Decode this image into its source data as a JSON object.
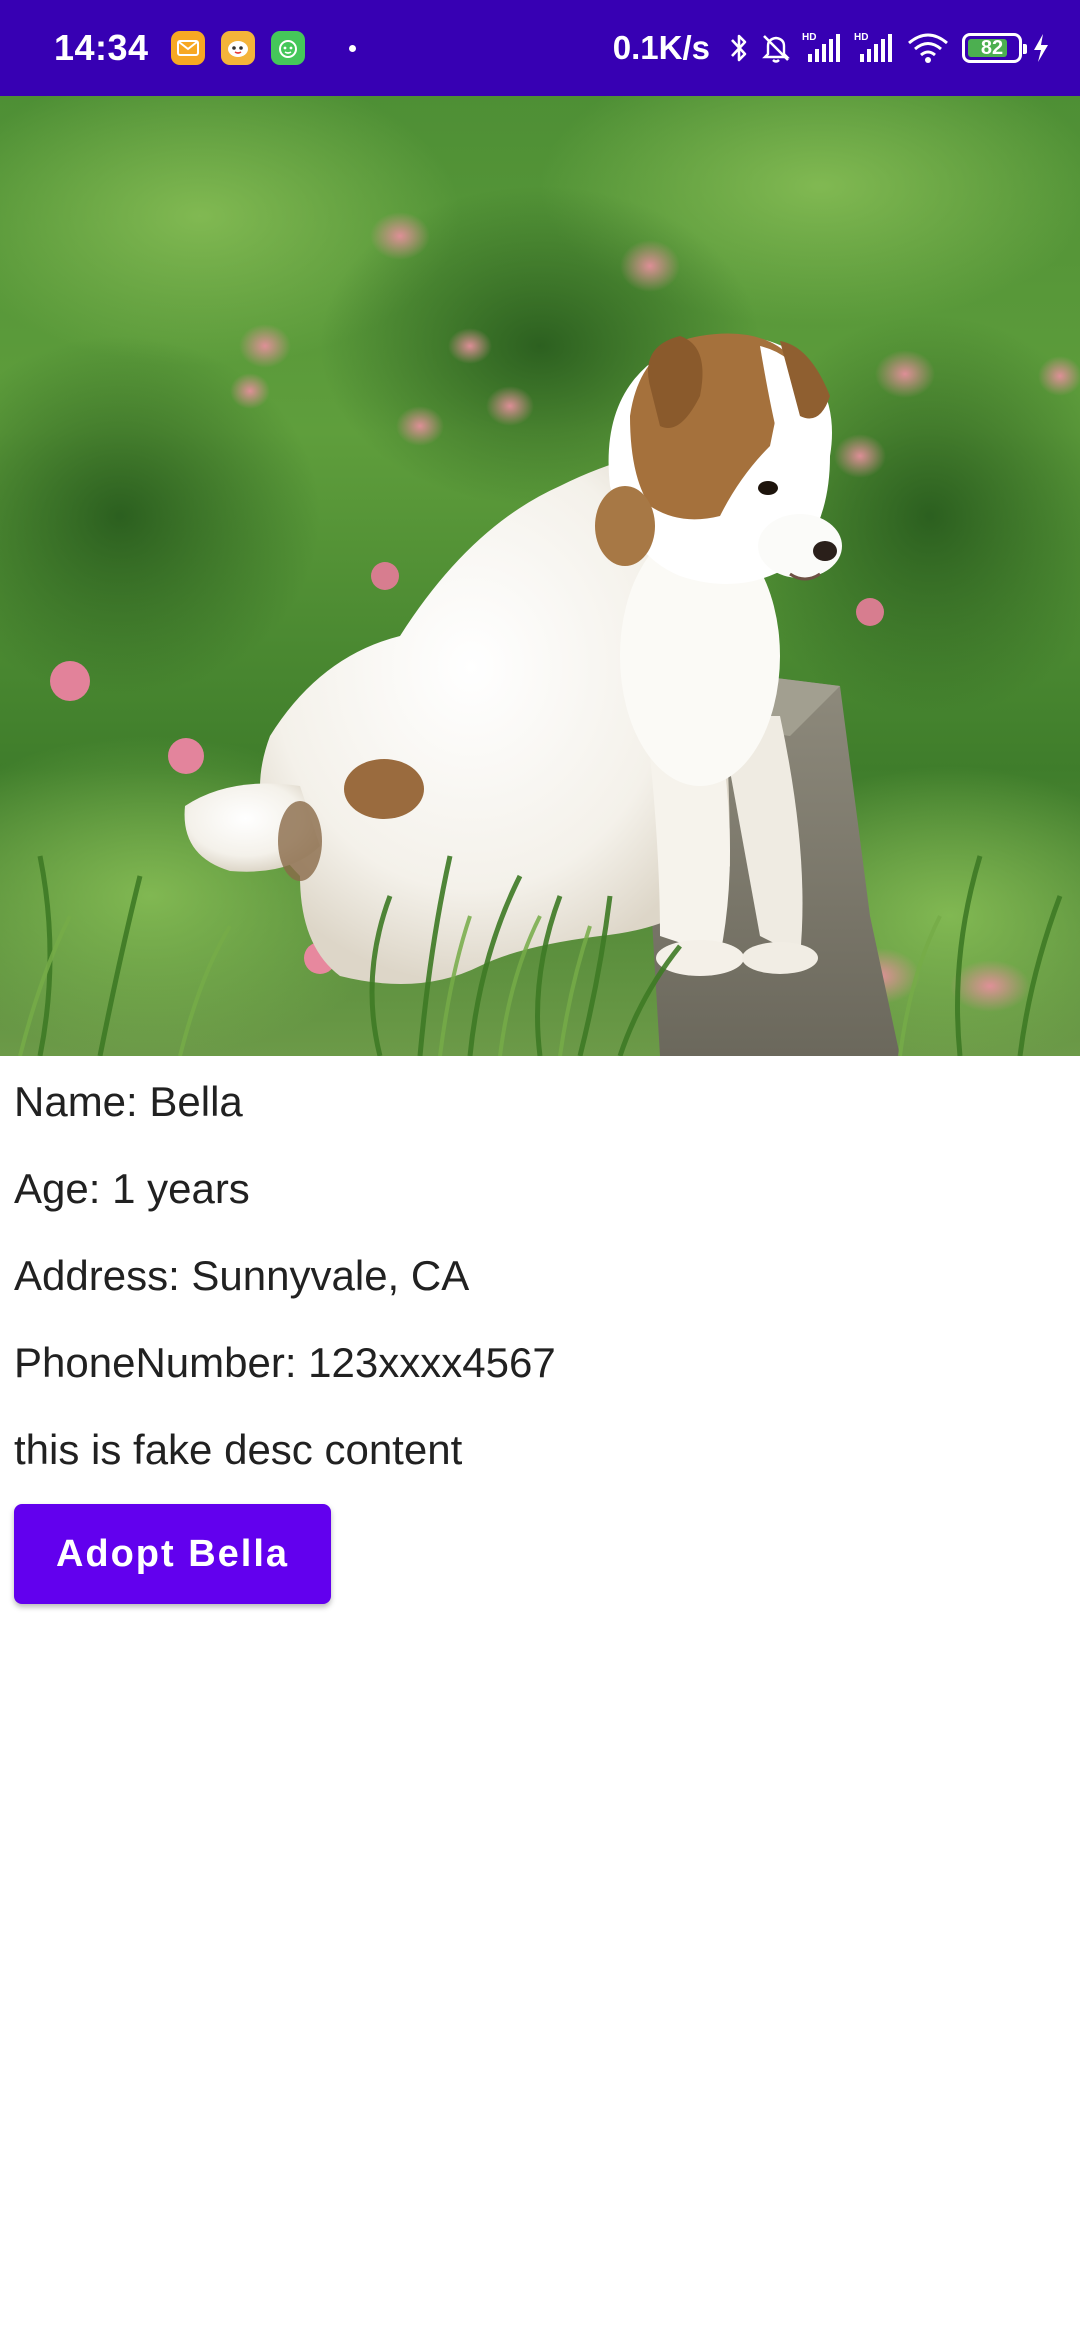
{
  "status_bar": {
    "time": "14:34",
    "network_speed": "0.1K/s",
    "battery_level": "82",
    "battery_fraction": 0.82,
    "background_color": "#3700b3",
    "notification_icons": [
      "mail-icon",
      "chat-app-icon",
      "green-app-icon"
    ],
    "system_icons": [
      "bluetooth-icon",
      "mute-icon",
      "signal-hd-icon",
      "signal-hd-icon",
      "wifi-icon",
      "battery-icon",
      "charging-icon"
    ]
  },
  "pet": {
    "image_icon": "dog-photo",
    "name_line": "Name: Bella",
    "age_line": "Age: 1 years",
    "address_line": "Address: Sunnyvale, CA",
    "phone_line": "PhoneNumber: 123xxxx4567",
    "description": "this is fake desc content"
  },
  "actions": {
    "adopt_label": "Adopt Bella",
    "button_color": "#6200ee"
  }
}
